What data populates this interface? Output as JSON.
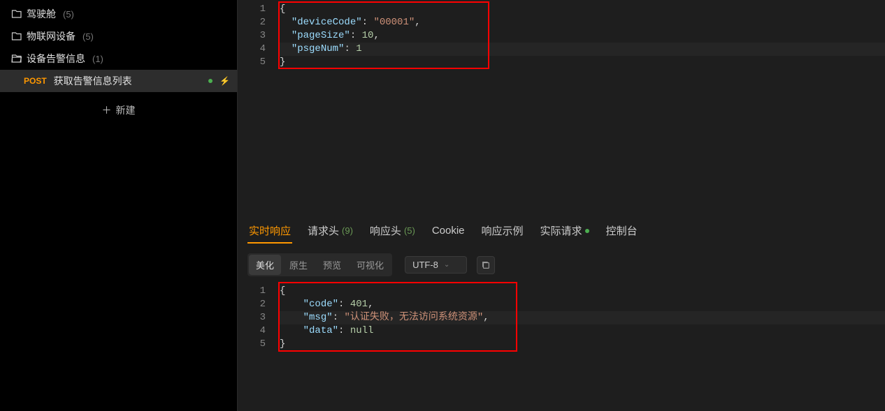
{
  "sidebar": {
    "items": [
      {
        "label": "驾驶舱",
        "count": "(5)"
      },
      {
        "label": "物联网设备",
        "count": "(5)"
      },
      {
        "label": "设备告警信息",
        "count": "(1)"
      }
    ],
    "selected": {
      "method": "POST",
      "label": "获取告警信息列表"
    },
    "new_label": "新建"
  },
  "request_body": {
    "lines": [
      {
        "n": "1",
        "tokens": [
          {
            "t": "{",
            "c": "punc"
          }
        ]
      },
      {
        "n": "2",
        "tokens": [
          {
            "t": "  ",
            "c": "punc"
          },
          {
            "t": "\"deviceCode\"",
            "c": "prop"
          },
          {
            "t": ": ",
            "c": "punc"
          },
          {
            "t": "\"00001\"",
            "c": "str"
          },
          {
            "t": ",",
            "c": "punc"
          }
        ]
      },
      {
        "n": "3",
        "tokens": [
          {
            "t": "  ",
            "c": "punc"
          },
          {
            "t": "\"pageSize\"",
            "c": "prop"
          },
          {
            "t": ": ",
            "c": "punc"
          },
          {
            "t": "10",
            "c": "num"
          },
          {
            "t": ",",
            "c": "punc"
          }
        ]
      },
      {
        "n": "4",
        "tokens": [
          {
            "t": "  ",
            "c": "punc"
          },
          {
            "t": "\"psgeNum\"",
            "c": "prop"
          },
          {
            "t": ": ",
            "c": "punc"
          },
          {
            "t": "1",
            "c": "num"
          }
        ]
      },
      {
        "n": "5",
        "tokens": [
          {
            "t": "}",
            "c": "punc"
          }
        ]
      }
    ]
  },
  "response_tabs": [
    {
      "label": "实时响应",
      "active": true
    },
    {
      "label": "请求头",
      "count": "(9)"
    },
    {
      "label": "响应头",
      "count": "(5)"
    },
    {
      "label": "Cookie"
    },
    {
      "label": "响应示例"
    },
    {
      "label": "实际请求",
      "dot": true
    },
    {
      "label": "控制台"
    }
  ],
  "toolbar": {
    "view_modes": [
      {
        "label": "美化",
        "active": true
      },
      {
        "label": "原生"
      },
      {
        "label": "预览"
      },
      {
        "label": "可视化"
      }
    ],
    "encoding": "UTF-8"
  },
  "response_body": {
    "lines": [
      {
        "n": "1",
        "tokens": [
          {
            "t": "{",
            "c": "punc"
          }
        ]
      },
      {
        "n": "2",
        "tokens": [
          {
            "t": "    ",
            "c": "punc"
          },
          {
            "t": "\"code\"",
            "c": "prop"
          },
          {
            "t": ": ",
            "c": "punc"
          },
          {
            "t": "401",
            "c": "num"
          },
          {
            "t": ",",
            "c": "punc"
          }
        ]
      },
      {
        "n": "3",
        "tokens": [
          {
            "t": "    ",
            "c": "punc"
          },
          {
            "t": "\"msg\"",
            "c": "prop"
          },
          {
            "t": ": ",
            "c": "punc"
          },
          {
            "t": "\"认证失败，无法访问系统资源\"",
            "c": "str"
          },
          {
            "t": ",",
            "c": "punc"
          }
        ]
      },
      {
        "n": "4",
        "tokens": [
          {
            "t": "    ",
            "c": "punc"
          },
          {
            "t": "\"data\"",
            "c": "prop"
          },
          {
            "t": ": ",
            "c": "punc"
          },
          {
            "t": "null",
            "c": "num"
          }
        ]
      },
      {
        "n": "5",
        "tokens": [
          {
            "t": "}",
            "c": "punc"
          }
        ]
      }
    ]
  }
}
